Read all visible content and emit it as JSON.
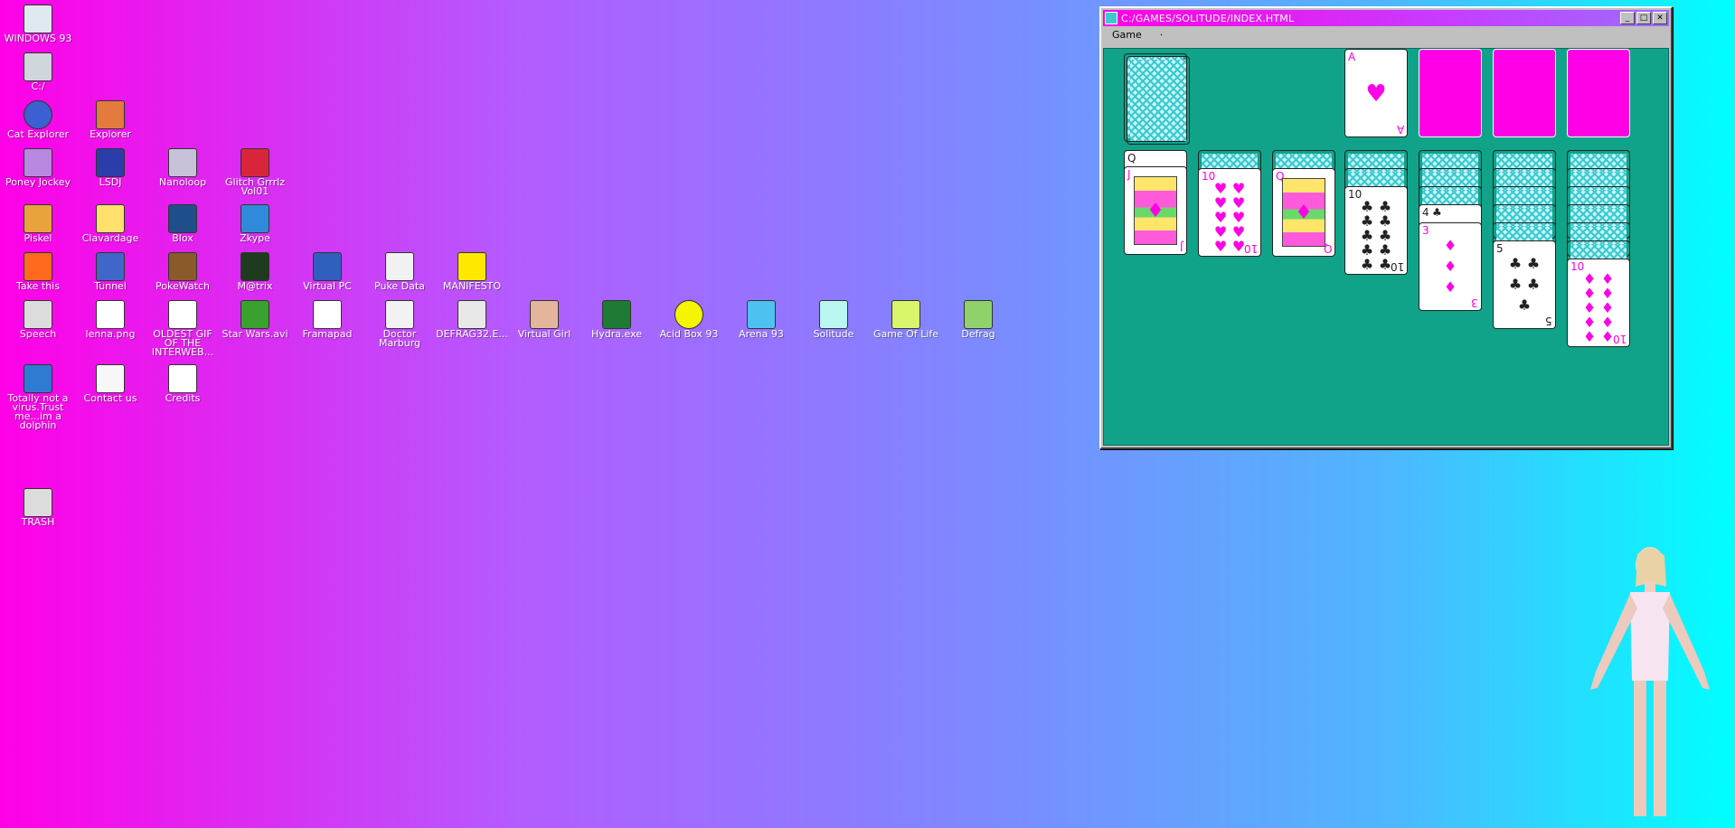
{
  "desktop": {
    "icons": [
      {
        "label": "WINDOWS 93",
        "icon": "computer-icon"
      },
      {
        "label": "C:/",
        "icon": "drive-icon"
      },
      {
        "label": "Cat Explorer",
        "icon": "cat-explorer-icon"
      },
      {
        "label": "Explorer",
        "icon": "explorer-icon"
      },
      {
        "label": "Poney Jockey",
        "icon": "pony-icon"
      },
      {
        "label": "LSDJ",
        "icon": "lsdj-icon"
      },
      {
        "label": "Nanoloop",
        "icon": "nanoloop-icon"
      },
      {
        "label": "Glitch Grrrlz Vol01",
        "icon": "lips-icon"
      },
      {
        "label": "Piskel",
        "icon": "palette-icon"
      },
      {
        "label": "Clavardage",
        "icon": "chat-icon"
      },
      {
        "label": "Blox",
        "icon": "blox-icon"
      },
      {
        "label": "Zkype",
        "icon": "zkype-icon"
      },
      {
        "label": "Take this",
        "icon": "take-this-icon"
      },
      {
        "label": "Tunnel",
        "icon": "tunnel-icon"
      },
      {
        "label": "PokeWatch",
        "icon": "pokewatch-icon"
      },
      {
        "label": "M@trix",
        "icon": "matrix-icon"
      },
      {
        "label": "Virtual PC",
        "icon": "virtual-pc-icon"
      },
      {
        "label": "Puke Data",
        "icon": "puke-data-icon"
      },
      {
        "label": "MANIFESTO",
        "icon": "question-icon"
      },
      {
        "label": "Speech",
        "icon": "speech-icon"
      },
      {
        "label": "lenna.png",
        "icon": "image-file-icon"
      },
      {
        "label": "OLDEST GIF OF THE INTERWEB...",
        "icon": "gif-file-icon"
      },
      {
        "label": "Star Wars.avi",
        "icon": "yoda-icon"
      },
      {
        "label": "Framapad",
        "icon": "framapad-icon"
      },
      {
        "label": "Doctor Marburg",
        "icon": "doctor-icon"
      },
      {
        "label": "DEFRAG32.E...",
        "icon": "defrag32-icon"
      },
      {
        "label": "Virtual Girl",
        "icon": "face-icon"
      },
      {
        "label": "Hydra.exe",
        "icon": "hydra-icon"
      },
      {
        "label": "Acid Box 93",
        "icon": "smiley-icon"
      },
      {
        "label": "Arena 93",
        "icon": "cube-icon"
      },
      {
        "label": "Solitude",
        "icon": "solitude-icon"
      },
      {
        "label": "Game Of Life",
        "icon": "game-of-life-icon"
      },
      {
        "label": "Defrag",
        "icon": "defrag-icon"
      },
      {
        "label": "Totally not a virus.Trust me...im a dolphin",
        "icon": "dolphin-icon"
      },
      {
        "label": "Contact us",
        "icon": "contact-icon"
      },
      {
        "label": "Credits",
        "icon": "document-icon"
      },
      {
        "label": "TRASH",
        "icon": "trash-icon"
      }
    ]
  },
  "window": {
    "title": "C:/GAMES/SOLITUDE/INDEX.HTML",
    "controls": {
      "minimize": "_",
      "maximize": "□",
      "close": "✕"
    },
    "menu": [
      "Game",
      "·"
    ]
  },
  "solitaire": {
    "foundation_ace": {
      "rank": "A",
      "suit": "♥"
    },
    "tableau": [
      {
        "top_rank": "J",
        "suit": "♦",
        "face_down": 0,
        "under_rank": "Q"
      },
      {
        "top_rank": "10",
        "suit": "♥",
        "face_down": 1
      },
      {
        "top_rank": "Q",
        "suit": "♦",
        "face_down": 1
      },
      {
        "top_rank": "10",
        "suit": "♣",
        "face_down": 2
      },
      {
        "top_rank": "3",
        "suit": "♦",
        "face_down": 3,
        "under_rank": "4",
        "under_suit": "♣"
      },
      {
        "top_rank": "5",
        "suit": "♣",
        "face_down": 5
      },
      {
        "top_rank": "10",
        "suit": "♦",
        "face_down": 6
      }
    ]
  }
}
